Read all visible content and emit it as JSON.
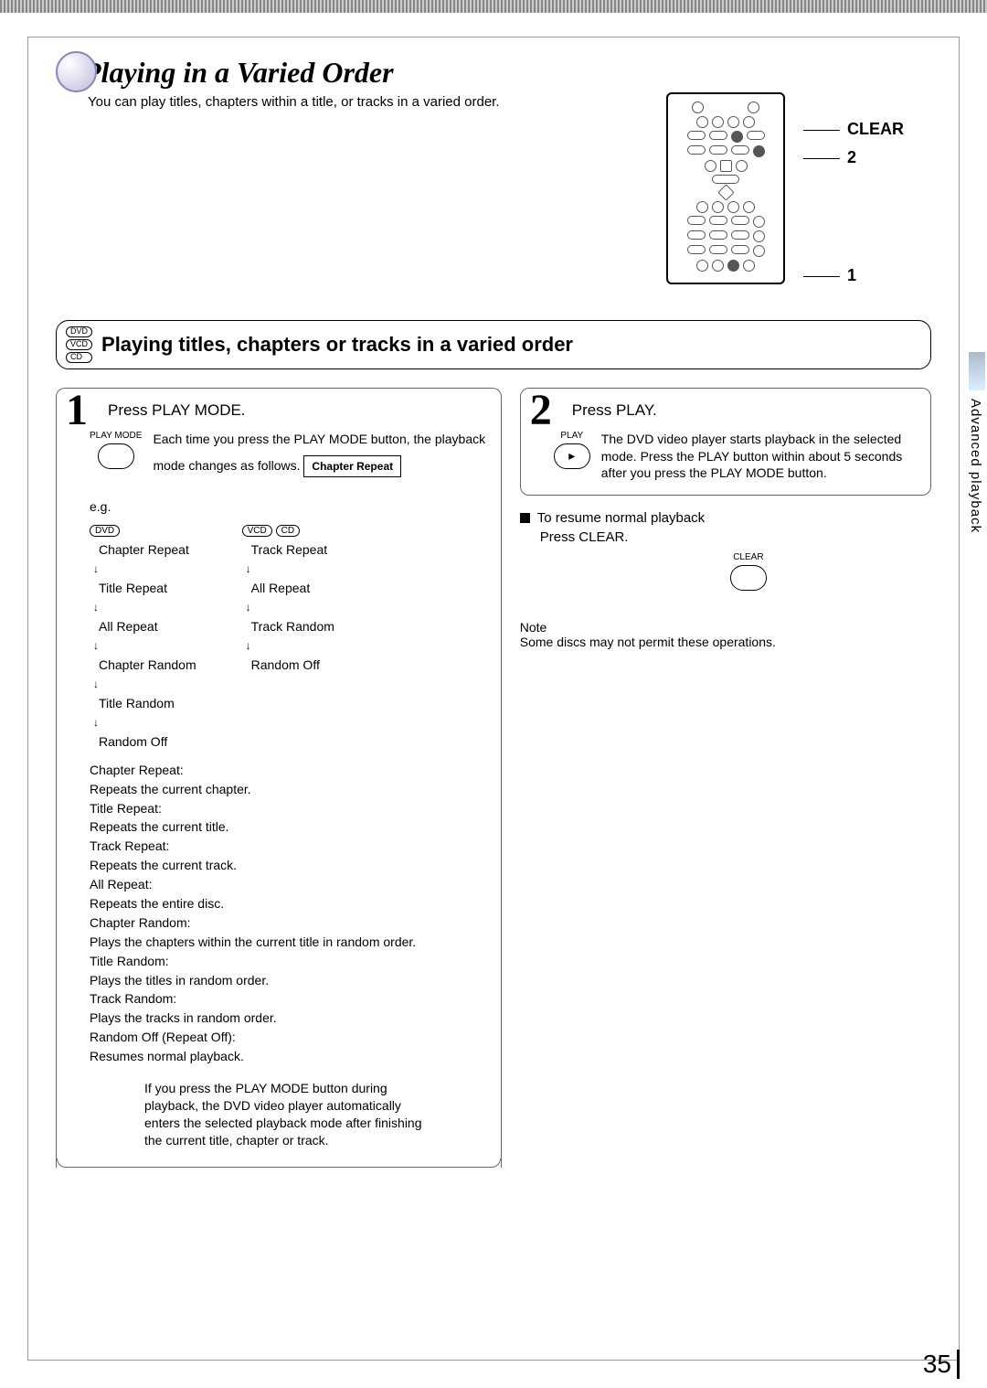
{
  "page": {
    "title": "Playing in a Varied Order",
    "subtitle": "You can play titles, chapters within a title, or tracks in a varied order.",
    "page_number": "35",
    "side_tab": "Advanced playback"
  },
  "remote": {
    "label_clear": "CLEAR",
    "label_2": "2",
    "label_1": "1"
  },
  "section": {
    "disc_tags": [
      "DVD",
      "VCD",
      "CD"
    ],
    "title": "Playing titles, chapters or tracks in a varied order"
  },
  "step1": {
    "num": "1",
    "head": "Press PLAY MODE.",
    "btn_label": "PLAY MODE",
    "body": "Each time you press the PLAY MODE button, the playback mode changes as follows.",
    "osd": "Chapter Repeat"
  },
  "eg": {
    "label": "e.g.",
    "dvd_tag": "DVD",
    "vcd_tag": "VCD",
    "cd_tag": "CD",
    "dvd_list": [
      "Chapter Repeat",
      "Title Repeat",
      "All Repeat",
      "Chapter Random",
      "Title Random",
      "Random Off"
    ],
    "cd_list": [
      "Track Repeat",
      "All Repeat",
      "Track Random",
      "Random Off"
    ]
  },
  "defs": {
    "items": [
      {
        "t": "Chapter Repeat:",
        "d": "Repeats the current chapter."
      },
      {
        "t": "Title Repeat:",
        "d": "Repeats the current title."
      },
      {
        "t": "Track Repeat:",
        "d": "Repeats the current track."
      },
      {
        "t": "All Repeat:",
        "d": "Repeats the entire disc."
      },
      {
        "t": "Chapter Random:",
        "d": "Plays the chapters within the current title in random order."
      },
      {
        "t": "Title Random:",
        "d": "Plays the titles in random order."
      },
      {
        "t": "Track Random:",
        "d": "Plays the tracks in random order."
      },
      {
        "t": "Random Off (Repeat Off):",
        "d": "Resumes normal playback."
      }
    ],
    "tip": "If you press the PLAY MODE button during playback, the DVD video player automatically enters the selected playback mode after finishing the current title, chapter or track."
  },
  "step2": {
    "num": "2",
    "head": "Press PLAY.",
    "btn_label": "PLAY",
    "body": "The DVD video player starts playback in the selected mode. Press the PLAY button within about 5 seconds after you press the PLAY MODE button."
  },
  "resume": {
    "head": "To resume normal playback",
    "instruction": "Press CLEAR.",
    "btn_label": "CLEAR"
  },
  "note": {
    "head": "Note",
    "body": "Some discs may not permit these operations."
  }
}
